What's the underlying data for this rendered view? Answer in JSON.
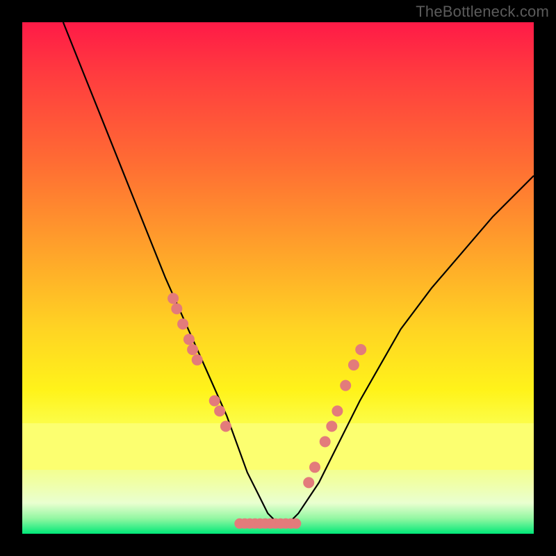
{
  "watermark": "TheBottleneck.com",
  "chart_data": {
    "type": "line",
    "title": "",
    "xlabel": "",
    "ylabel": "",
    "xlim": [
      0,
      100
    ],
    "ylim": [
      0,
      100
    ],
    "curve": {
      "name": "bottleneck-curve",
      "x": [
        8,
        12,
        16,
        20,
        24,
        28,
        32,
        36,
        40,
        44,
        46,
        48,
        50,
        52,
        54,
        58,
        62,
        66,
        70,
        74,
        80,
        86,
        92,
        100
      ],
      "y": [
        100,
        90,
        80,
        70,
        60,
        50,
        41,
        32,
        23,
        12,
        8,
        4,
        2,
        2,
        4,
        10,
        18,
        26,
        33,
        40,
        48,
        55,
        62,
        70
      ]
    },
    "dots_left": {
      "name": "left-band-markers",
      "x": [
        29.5,
        30.2,
        31.4,
        32.6,
        33.3,
        34.2,
        37.6,
        38.6,
        39.8
      ],
      "y": [
        46,
        44,
        41,
        38,
        36,
        34,
        26,
        24,
        21
      ]
    },
    "dots_right": {
      "name": "right-band-markers",
      "x": [
        56.0,
        57.2,
        59.2,
        60.5,
        61.6,
        63.2,
        64.8,
        66.2
      ],
      "y": [
        10,
        13,
        18,
        21,
        24,
        29,
        33,
        36
      ]
    },
    "valley_bar": {
      "name": "valley-dot-row",
      "x": [
        42.5,
        43.5,
        44.5,
        45.5,
        46.5,
        47.5,
        48.5,
        49.5,
        50.5,
        51.5,
        52.5,
        53.5
      ],
      "y": [
        2,
        2,
        2,
        2,
        2,
        2,
        2,
        2,
        2,
        2,
        2,
        2
      ]
    },
    "gradient_stops": [
      {
        "offset": 0,
        "color": "#ff1a47"
      },
      {
        "offset": 28,
        "color": "#ff6e33"
      },
      {
        "offset": 60,
        "color": "#ffd423"
      },
      {
        "offset": 80,
        "color": "#fbff53"
      },
      {
        "offset": 97,
        "color": "#93f7a2"
      },
      {
        "offset": 100,
        "color": "#00e878"
      }
    ],
    "yellow_band_y": [
      12.5,
      21.5
    ],
    "dot_color": "#e37b7b",
    "curve_color": "#000000"
  }
}
